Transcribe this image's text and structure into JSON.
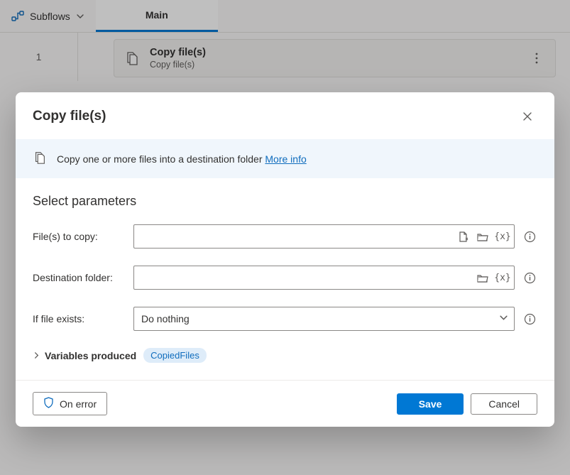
{
  "topbar": {
    "subflows_label": "Subflows",
    "tab_main": "Main"
  },
  "canvas": {
    "line_number": "1",
    "action_title": "Copy file(s)",
    "action_sub": "Copy file(s)"
  },
  "dialog": {
    "title": "Copy file(s)",
    "banner_text": "Copy one or more files into a destination folder",
    "banner_link": "More info",
    "section_title": "Select parameters",
    "fields": {
      "files_to_copy_label": "File(s) to copy:",
      "files_to_copy_value": "",
      "destination_label": "Destination folder:",
      "destination_value": "",
      "if_exists_label": "If file exists:",
      "if_exists_value": "Do nothing"
    },
    "variables_produced_label": "Variables produced",
    "variable_chip": "CopiedFiles",
    "footer": {
      "on_error": "On error",
      "save": "Save",
      "cancel": "Cancel"
    }
  }
}
